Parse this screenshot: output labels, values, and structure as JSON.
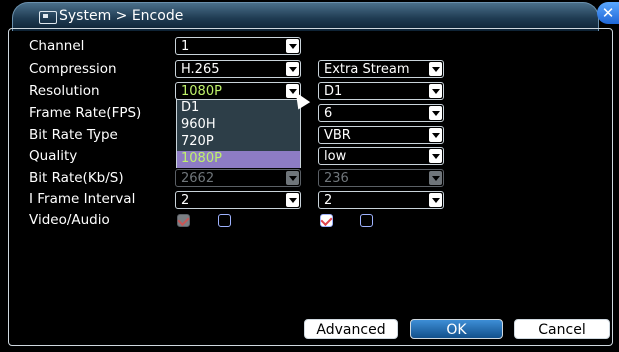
{
  "window": {
    "title": "System > Encode",
    "close_glyph": "✕"
  },
  "labels": {
    "channel": "Channel",
    "compression": "Compression",
    "resolution": "Resolution",
    "frame_rate": "Frame Rate(FPS)",
    "bit_rate_type": "Bit Rate Type",
    "quality": "Quality",
    "bit_rate": "Bit Rate(Kb/S)",
    "i_frame_interval": "I Frame Interval",
    "video_audio": "Video/Audio"
  },
  "main_stream": {
    "channel": "1",
    "compression": "H.265",
    "resolution": "1080P",
    "bit_rate": "2662",
    "i_frame_interval": "2",
    "video_checked": true,
    "audio_checked": false
  },
  "extra_stream": {
    "name": "Extra Stream",
    "resolution": "D1",
    "frame_rate": "6",
    "bit_rate_type": "VBR",
    "quality": "low",
    "bit_rate": "236",
    "i_frame_interval": "2",
    "video_checked": true,
    "audio_checked": false
  },
  "resolution_dropdown": {
    "options": [
      "D1",
      "960H",
      "720P",
      "1080P"
    ],
    "selected": "1080P"
  },
  "buttons": {
    "advanced": "Advanced",
    "ok": "OK",
    "cancel": "Cancel"
  },
  "colors": {
    "selected_text": "#bff26b",
    "selected_bg": "#8d7cc4",
    "title_bar": "#1f3b52"
  }
}
